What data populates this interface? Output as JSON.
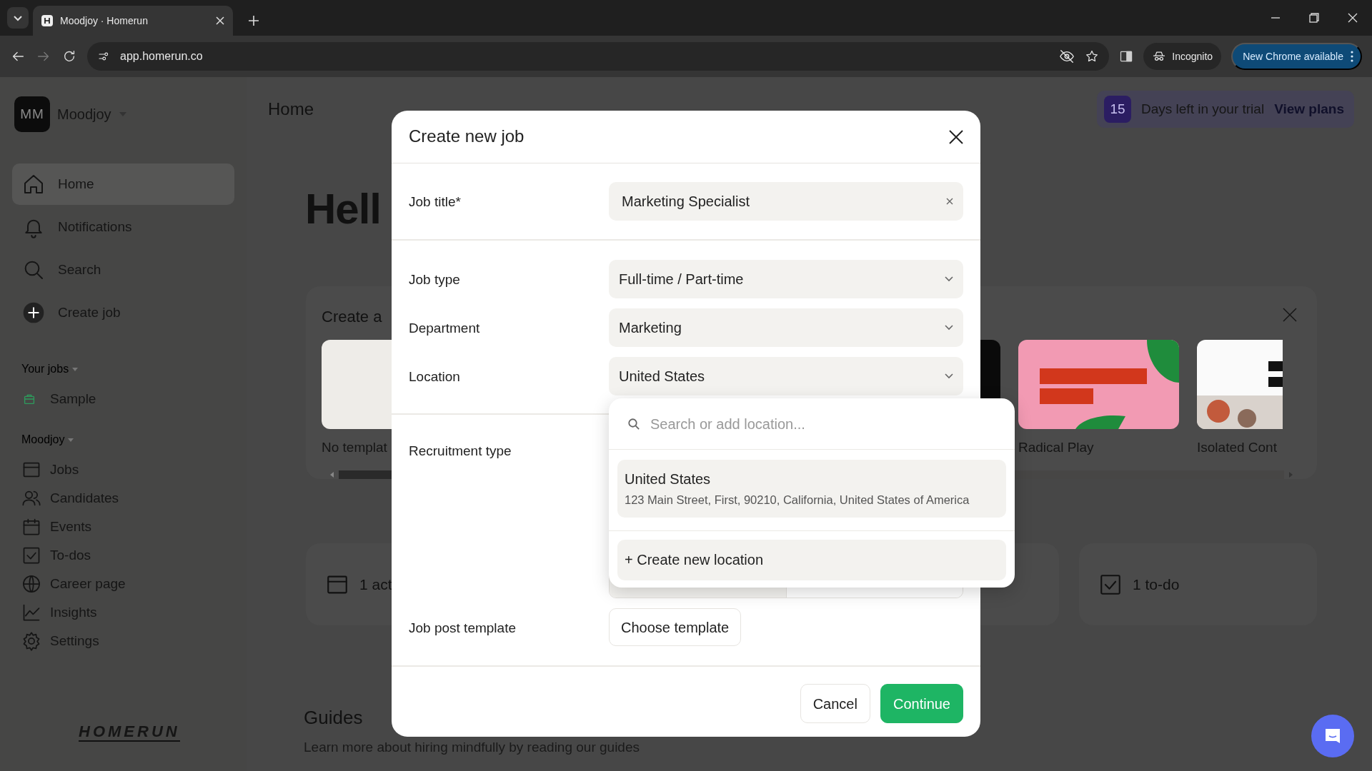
{
  "browser": {
    "tabs": [
      {
        "title": "Moodjoy · Homerun",
        "selected": true
      }
    ],
    "address": "app.homerun.co",
    "profile": "Incognito",
    "update_button": "New Chrome available"
  },
  "sidebar": {
    "workspace": {
      "initials": "MM",
      "name": "Moodjoy"
    },
    "nav": [
      {
        "label": "Home",
        "selected": true
      },
      {
        "label": "Notifications",
        "selected": false
      },
      {
        "label": "Search",
        "selected": false
      },
      {
        "label": "Create job",
        "selected": false
      }
    ],
    "sections": [
      {
        "title": "Your jobs",
        "items": [
          {
            "label": "Sample"
          }
        ]
      },
      {
        "title": "Moodjoy",
        "items": [
          {
            "label": "Jobs"
          },
          {
            "label": "Candidates"
          },
          {
            "label": "Events"
          },
          {
            "label": "To-dos"
          },
          {
            "label": "Career page"
          },
          {
            "label": "Insights"
          },
          {
            "label": "Settings"
          }
        ]
      }
    ],
    "logo": "HOMERUN"
  },
  "main": {
    "page_title": "Home",
    "trial": {
      "days": "15",
      "text": "Days left in your trial",
      "link": "View plans"
    },
    "greeting": "Hell",
    "template_card": {
      "title": "Create a",
      "templates": [
        {
          "kind": "blank",
          "label": "No templat"
        },
        {
          "kind": "dark"
        },
        {
          "kind": "pink",
          "label": "Radical Play"
        },
        {
          "label": "Isolated Cont"
        }
      ]
    },
    "stats": [
      {
        "label": "1 act"
      },
      {
        "label": "1 to-do"
      }
    ],
    "guides": {
      "title": "Guides",
      "text": "Learn more about hiring mindfully by reading our guides"
    }
  },
  "modal": {
    "title": "Create new job",
    "sections": [
      {
        "fields": [
          {
            "kind": "text",
            "label": "Job title*",
            "value": "Marketing Specialist"
          }
        ]
      },
      {
        "fields": [
          {
            "kind": "select",
            "label": "Job type",
            "value": "Full-time / Part-time"
          },
          {
            "kind": "select",
            "label": "Department",
            "value": "Marketing"
          },
          {
            "kind": "select",
            "label": "Location",
            "value": "United States"
          }
        ]
      },
      {
        "fields": [
          {
            "kind": "segmented",
            "label": "Recruitment type"
          },
          {
            "kind": "button",
            "label": "Job post template",
            "value": "Choose template"
          }
        ]
      }
    ],
    "dropdown": {
      "placeholder": "Search or add location...",
      "options": [
        {
          "title": "United States",
          "subtitle": "123 Main Street, First, 90210, California, United States of America"
        }
      ],
      "create": "+ Create new location"
    },
    "buttons": [
      {
        "label": "Cancel",
        "kind": "secondary"
      },
      {
        "label": "Continue",
        "kind": "primary"
      }
    ]
  }
}
